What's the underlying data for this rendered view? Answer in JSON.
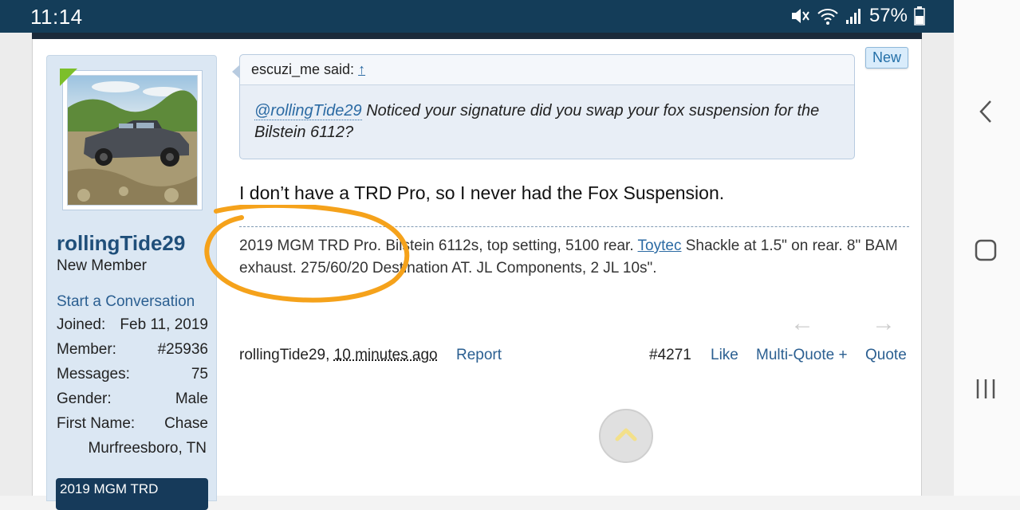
{
  "status_bar": {
    "time": "11:14",
    "battery": "57%"
  },
  "sidebar": {
    "username": "rollingTide29",
    "user_title": "New Member",
    "start_conversation": "Start a Conversation",
    "stats": [
      {
        "label": "Joined:",
        "value": "Feb 11, 2019"
      },
      {
        "label": "Member:",
        "value": "#25936"
      },
      {
        "label": "Messages:",
        "value": "75"
      },
      {
        "label": "Gender:",
        "value": "Male"
      },
      {
        "label": "First Name:",
        "value": "Chase"
      }
    ],
    "location": "Murfreesboro, TN",
    "signature_badge": "2019 MGM TRD"
  },
  "post": {
    "new_badge": "New",
    "quote": {
      "author_said": "escuzi_me said:",
      "jump_arrow": "↑",
      "mention": "@rollingTide29",
      "text": " Noticed your signature did you swap your fox suspension for the Bilstein 6112?"
    },
    "body": "I don’t have a TRD Pro, so I never had the Fox Suspension.",
    "signature": {
      "part1": "2019 MGM TRD Pro. Bilstein 6112s, top setting, 5100 rear. ",
      "link": "Toytec",
      "part2": " Shackle at 1.5\" on rear. 8\" BAM exhaust. 275/60/20 Destination AT. JL Components, 2 JL 10s\"."
    },
    "footer": {
      "author": "rollingTide29,",
      "time": "10 minutes ago",
      "report": "Report",
      "post_number": "#4271",
      "like": "Like",
      "multi_quote": "Multi-Quote +",
      "quote": "Quote"
    }
  },
  "colors": {
    "status_bar": "#143d59",
    "link": "#2b5f91",
    "annotation": "#f5a21b"
  },
  "icons": [
    "mute-icon",
    "wifi-icon",
    "signal-icon",
    "battery-icon",
    "back-icon",
    "home-icon",
    "recents-icon",
    "arrow-left-icon",
    "arrow-right-icon",
    "scroll-top-icon"
  ]
}
